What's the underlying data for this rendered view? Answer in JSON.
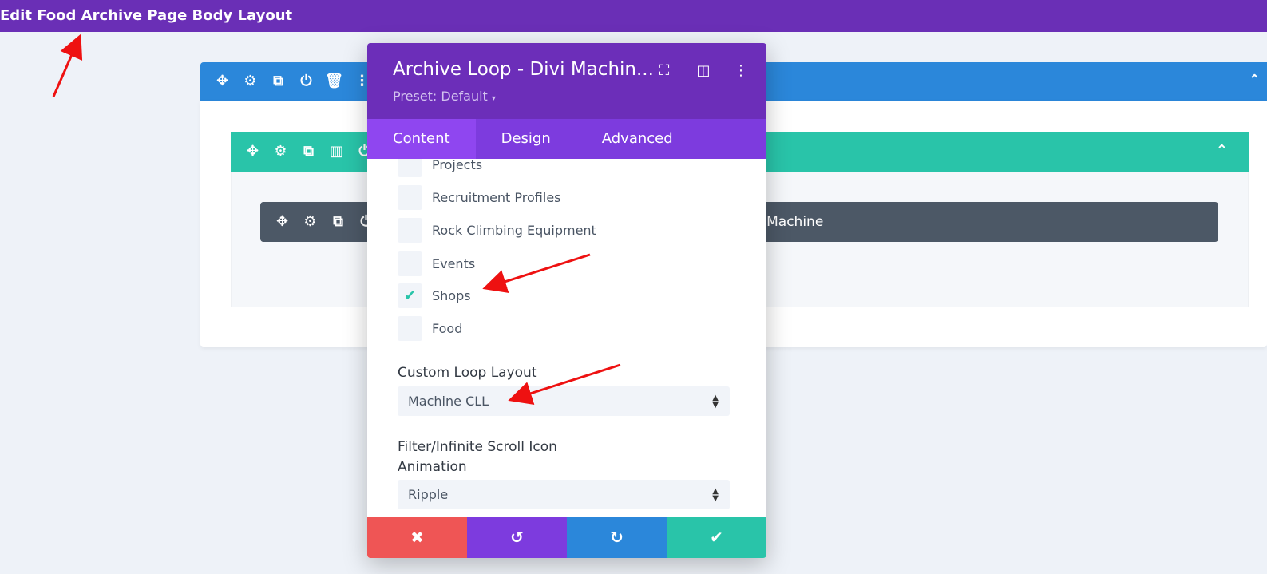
{
  "page": {
    "title": "Edit Food Archive Page Body Layout"
  },
  "builder": {
    "module_label": "i Machine"
  },
  "modal": {
    "title": "Archive Loop - Divi Machin...",
    "preset": "Preset: Default",
    "tabs": [
      "Content",
      "Design",
      "Advanced"
    ],
    "active_tab": "Content",
    "post_types": [
      {
        "label": "Projects",
        "checked": false
      },
      {
        "label": "Recruitment Profiles",
        "checked": false
      },
      {
        "label": "Rock Climbing Equipment",
        "checked": false
      },
      {
        "label": "Events",
        "checked": false
      },
      {
        "label": "Shops",
        "checked": true
      },
      {
        "label": "Food",
        "checked": false
      }
    ],
    "custom_loop_layout": {
      "label": "Custom Loop Layout",
      "value": "Machine CLL"
    },
    "filter_animation": {
      "label_line1": "Filter/Infinite Scroll Icon",
      "label_line2": "Animation",
      "value": "Ripple"
    }
  },
  "colors": {
    "purple_header": "#6c2eb9",
    "section_blue": "#2b87da",
    "row_teal": "#29c4a9",
    "module_dark": "#4c5866",
    "cancel_red": "#ef5555",
    "undo_purple": "#7d3bde",
    "redo_blue": "#2b87da",
    "save_teal": "#29c4a9",
    "annotation_red": "#ee1111"
  }
}
